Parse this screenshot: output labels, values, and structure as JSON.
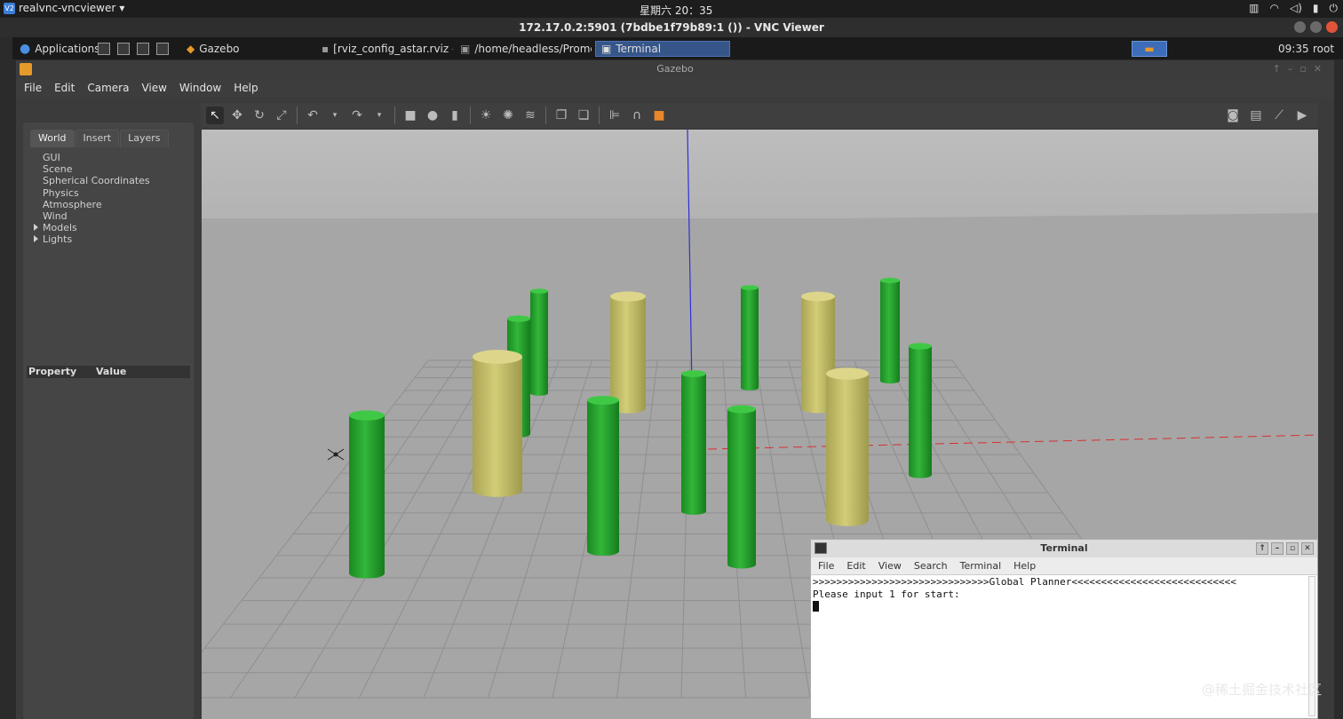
{
  "topbar": {
    "app_name": "realvnc-vncviewer",
    "clock": "星期六 20：35",
    "tray_user": "root"
  },
  "vnc": {
    "title": "172.17.0.2:5901 (7bdbe1f79b89:1 ()) - VNC Viewer"
  },
  "panel": {
    "applications": "Applications",
    "tasks": [
      {
        "label": "Gazebo"
      },
      {
        "label": "[rviz_config_astar.rviz - ..."
      },
      {
        "label": "/home/headless/Promet..."
      },
      {
        "label": "Terminal"
      }
    ],
    "time": "09:35",
    "user": "root"
  },
  "gazebo": {
    "title": "Gazebo",
    "menu": [
      "File",
      "Edit",
      "Camera",
      "View",
      "Window",
      "Help"
    ],
    "tabs": [
      "World",
      "Insert",
      "Layers"
    ],
    "tree": [
      "GUI",
      "Scene",
      "Spherical Coordinates",
      "Physics",
      "Atmosphere",
      "Wind",
      "Models",
      "Lights"
    ],
    "property_header": {
      "property": "Property",
      "value": "Value"
    }
  },
  "terminal": {
    "title": "Terminal",
    "menu": [
      "File",
      "Edit",
      "View",
      "Search",
      "Terminal",
      "Help"
    ],
    "line1": ">>>>>>>>>>>>>>>>>>>>>>>>>>>>>>Global Planner<<<<<<<<<<<<<<<<<<<<<<<<<<<<",
    "line2": "Please input 1 for start:"
  },
  "watermark": "@稀土掘金技术社区",
  "colors": {
    "green_cylinder": "#2aa52f",
    "yellow_cylinder": "#c9c36a",
    "panel_active": "#36568a"
  }
}
